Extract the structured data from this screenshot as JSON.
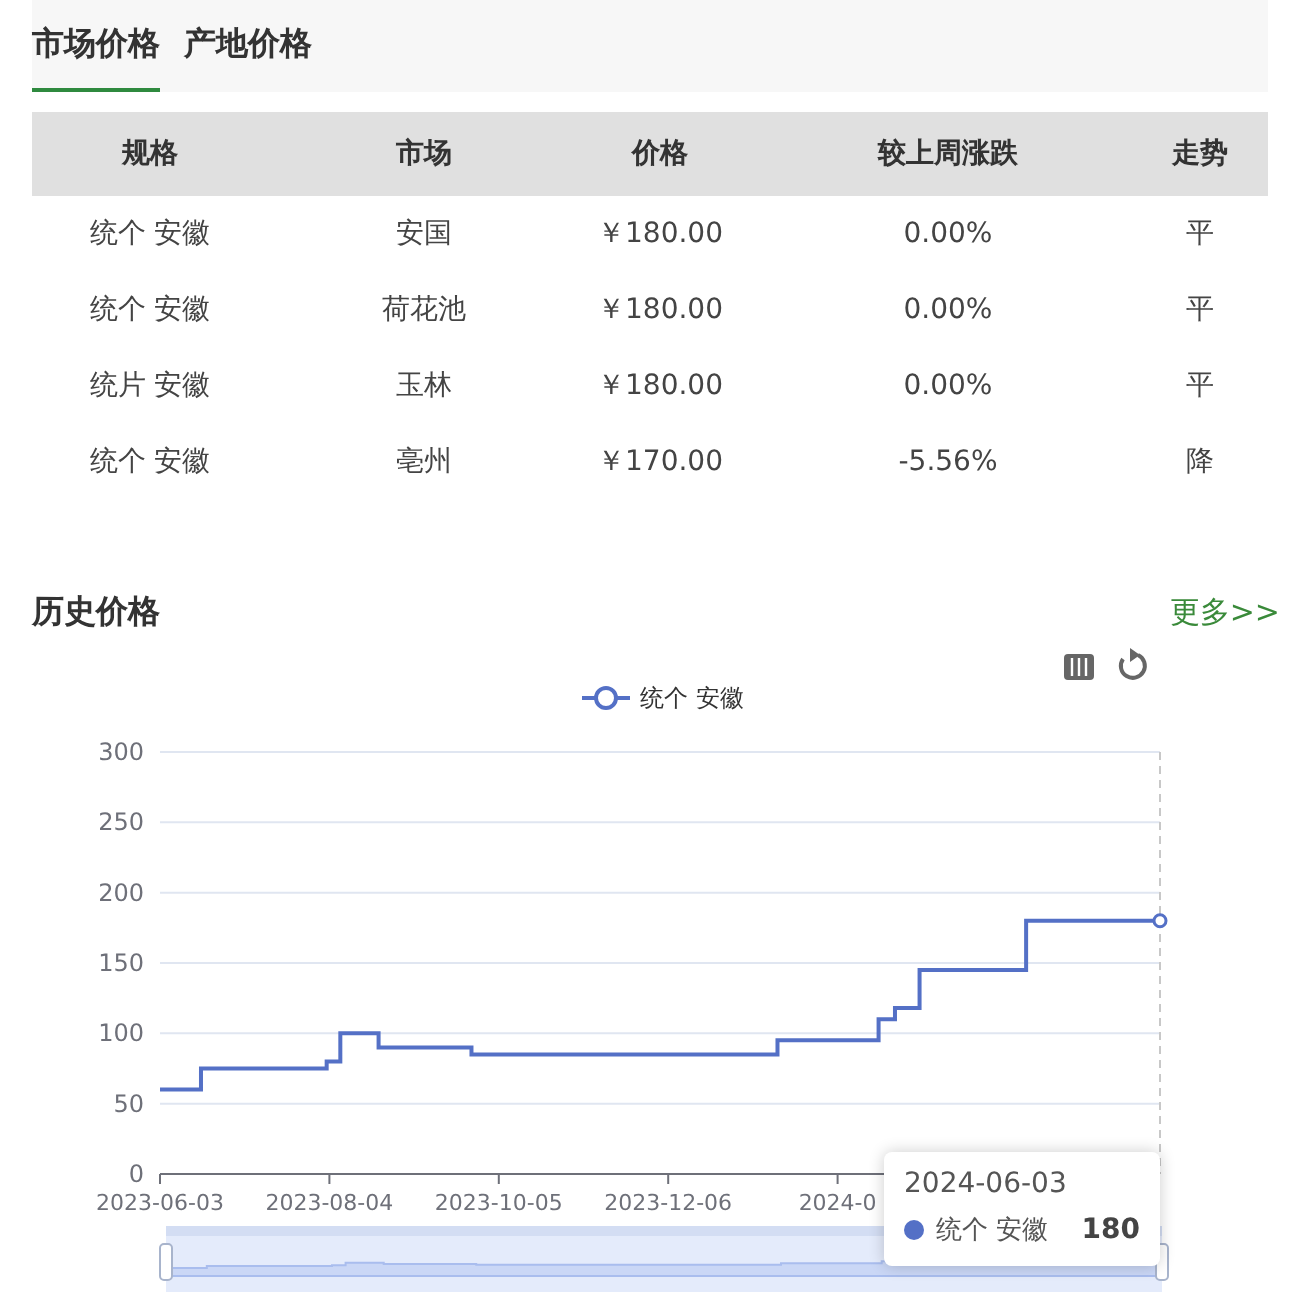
{
  "tabs": [
    {
      "label": "市场价格",
      "selected": true
    },
    {
      "label": "产地价格",
      "selected": false
    }
  ],
  "table": {
    "columns": [
      "规格",
      "市场",
      "价格",
      "较上周涨跌",
      "走势"
    ],
    "rows": [
      [
        "统个 安徽",
        "安国",
        "￥180.00",
        "0.00%",
        "平"
      ],
      [
        "统个 安徽",
        "荷花池",
        "￥180.00",
        "0.00%",
        "平"
      ],
      [
        "统片 安徽",
        "玉林",
        "￥180.00",
        "0.00%",
        "平"
      ],
      [
        "统个 安徽",
        "亳州",
        "￥170.00",
        "-5.56%",
        "降"
      ]
    ]
  },
  "history": {
    "title": "历史价格",
    "more_link": "更多>>",
    "chart_data": {
      "type": "line",
      "grid": true,
      "x": [
        "2023-06-03",
        "2023-06-18",
        "2023-06-18",
        "2023-08-03",
        "2023-08-03",
        "2023-08-08",
        "2023-08-08",
        "2023-08-22",
        "2023-08-22",
        "2023-09-25",
        "2023-09-25",
        "2024-01-15",
        "2024-01-15",
        "2024-02-21",
        "2024-02-21",
        "2024-02-27",
        "2024-02-27",
        "2024-03-07",
        "2024-03-07",
        "2024-04-15",
        "2024-04-15",
        "2024-06-03"
      ],
      "series": [
        {
          "name": "统个 安徽",
          "color": "#5470c6",
          "values": [
            60,
            60,
            75,
            75,
            80,
            80,
            100,
            100,
            90,
            90,
            85,
            85,
            95,
            95,
            110,
            110,
            118,
            118,
            145,
            145,
            180,
            180
          ]
        }
      ],
      "xlim": [
        "2023-06-03",
        "2024-06-03"
      ],
      "xticks": [
        {
          "value": "2023-06-03",
          "label": "2023-06-03"
        },
        {
          "value": "2023-08-04",
          "label": "2023-08-04"
        },
        {
          "value": "2023-10-05",
          "label": "2023-10-05"
        },
        {
          "value": "2023-12-06",
          "label": "2023-12-06"
        },
        {
          "value": "2024-02-06",
          "label": "2024-0"
        }
      ],
      "ylim": [
        0,
        300
      ],
      "yticks": [
        0,
        50,
        100,
        150,
        200,
        250,
        300
      ]
    },
    "tooltip": {
      "date": "2024-06-03",
      "series_name": "统个 安徽",
      "value": "180",
      "color": "#5470c6"
    }
  }
}
